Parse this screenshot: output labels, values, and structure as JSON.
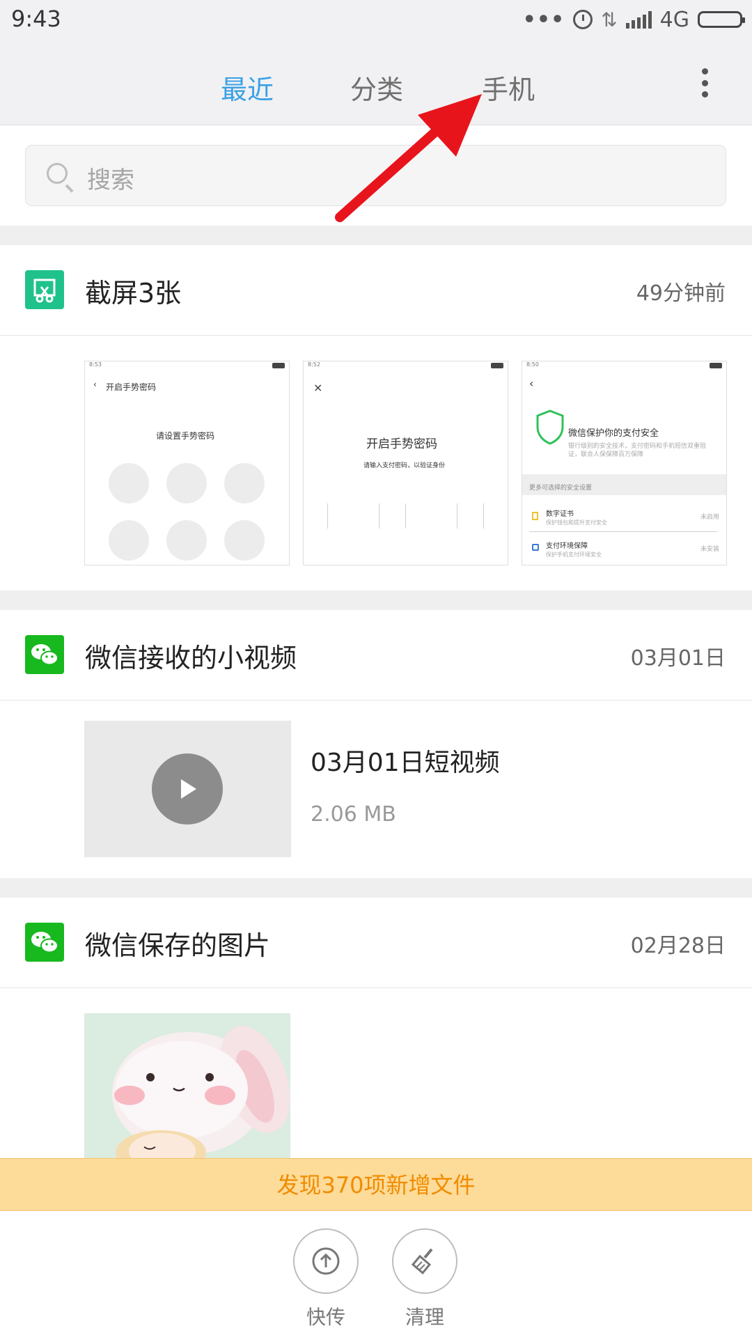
{
  "status_bar": {
    "time": "9:43",
    "dots": "•••",
    "network": "4G",
    "battery_level": 1.0
  },
  "tabs": [
    {
      "label": "最近",
      "active": true
    },
    {
      "label": "分类",
      "active": false
    },
    {
      "label": "手机",
      "active": false
    }
  ],
  "search": {
    "placeholder": "搜索"
  },
  "groups": [
    {
      "title": "截屏3张",
      "date": "49分钟前",
      "icon": "screenshot-scissors-icon",
      "icon_color": "#20c28b",
      "thumbs": [
        {
          "time": "8:53",
          "title": "开启手势密码",
          "subtitle": "请设置手势密码"
        },
        {
          "time": "8:52",
          "title": "开启手势密码",
          "subtitle": "请输入支付密码，以验证身份"
        },
        {
          "time": "8:50",
          "title": "微信保护你的支付安全",
          "subtitle": "银行级别的安全技术，支付密码和手机短信双重验证，联合人保保障百万保障",
          "section": "更多可选择的安全设置",
          "rows": [
            {
              "title": "数字证书",
              "desc": "保护钱包和提升支付安全",
              "state": "未启用"
            },
            {
              "title": "支付环境保障",
              "desc": "保护手机支付环境安全",
              "state": "未安装"
            }
          ]
        }
      ]
    },
    {
      "title": "微信接收的小视频",
      "date": "03月01日",
      "icon": "wechat-icon",
      "icon_color": "#18b81f",
      "video": {
        "name": "03月01日短视频",
        "size": "2.06 MB"
      }
    },
    {
      "title": "微信保存的图片",
      "date": "02月28日",
      "icon": "wechat-icon",
      "icon_color": "#18b81f"
    }
  ],
  "banner": {
    "text": "发现370项新增文件"
  },
  "actions": [
    {
      "label": "快传",
      "icon": "upload-icon"
    },
    {
      "label": "清理",
      "icon": "broom-icon"
    }
  ],
  "colors": {
    "accent": "#3aa0e6",
    "banner_bg": "#fddb99",
    "banner_text": "#f08c00",
    "annotation_arrow": "#e8141c"
  }
}
